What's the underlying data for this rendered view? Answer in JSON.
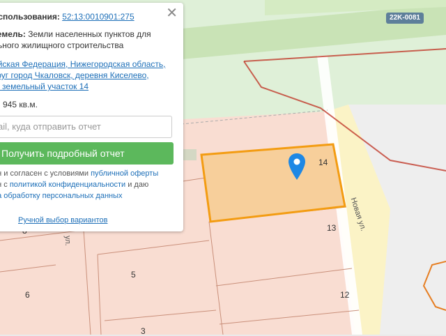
{
  "map": {
    "road_badge": "22K-0081",
    "street_label": "Новая ул.",
    "street_label_2": "ул.",
    "plot_numbers": [
      "14",
      "13",
      "12",
      "5",
      "6",
      "3",
      "8"
    ]
  },
  "popup": {
    "cadastre_label": "использования:",
    "cadastre_number": "52:13:0010901:275",
    "category_label": "земель:",
    "category_value_1": "Земли населенных пунктов для",
    "category_value_2": "льного жилищного строительства",
    "address_1": "ийская Федерация, Нижегородская область,",
    "address_2": "круг город Чкаловск, деревня Киселево,",
    "address_3": "в, земельный участок 14",
    "area": "945 кв.м.",
    "email_placeholder": "ail, куда отправить отчет",
    "report_button": "Получить подробный отчет",
    "terms_1_text": "ен и согласен с условиями",
    "terms_1_link": "публичной оферты",
    "terms_2_text": "ен с",
    "terms_2_link": "политикой конфиденциальности",
    "terms_2_tail": "и даю",
    "terms_3_link": "на обработку персональных данных",
    "manual_link": "Ручной выбор вариантов",
    "close_icon": "close-icon"
  },
  "colors": {
    "selected_plot_fill": "#f7cf9b",
    "selected_plot_border": "#f39c12",
    "button_green": "#5cb85c",
    "link_blue": "#1d6fb8",
    "boundary_red": "#c0392b"
  }
}
